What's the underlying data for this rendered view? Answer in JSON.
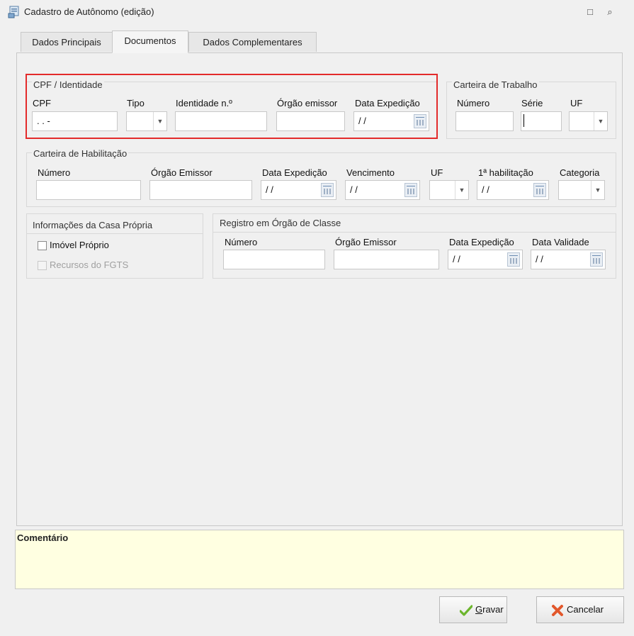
{
  "window": {
    "title": "Cadastro de Autônomo (edição)",
    "controls": {
      "restore_icon": "restore-icon",
      "close_icon": "close-icon"
    }
  },
  "tabs": [
    {
      "label": "Dados Principais",
      "active": false
    },
    {
      "label": "Documentos",
      "active": true
    },
    {
      "label": "Dados Complementares",
      "active": false
    }
  ],
  "cpf_group": {
    "title": "CPF / Identidade",
    "cpf_label": "CPF",
    "cpf_value": " .  .  -",
    "tipo_label": "Tipo",
    "tipo_value": "",
    "identidade_label": "Identidade n.º",
    "identidade_value": "",
    "orgao_label": "Órgão emissor",
    "orgao_value": "",
    "data_label": "Data Expedição",
    "data_value": "/ /"
  },
  "ctps_group": {
    "title": "Carteira de Trabalho",
    "numero_label": "Número",
    "numero_value": "",
    "serie_label": "Série",
    "serie_value": "",
    "uf_label": "UF",
    "uf_value": ""
  },
  "cnh_group": {
    "title": "Carteira de Habilitação",
    "numero_label": "Número",
    "numero_value": "",
    "orgao_label": "Órgão Emissor",
    "orgao_value": "",
    "data_exp_label": "Data Expedição",
    "data_exp_value": "/ /",
    "vencimento_label": "Vencimento",
    "vencimento_value": "/ /",
    "uf_label": "UF",
    "uf_value": "",
    "primeira_label": "1ª habilitação",
    "primeira_value": "/ /",
    "categoria_label": "Categoria",
    "categoria_value": ""
  },
  "casa_group": {
    "title": "Informações da Casa Própria",
    "imovel_label": "Imóvel Próprio",
    "imovel_checked": false,
    "fgts_label": "Recursos do FGTS",
    "fgts_checked": false
  },
  "classe_group": {
    "title": "Registro em Órgão de Classe",
    "numero_label": "Número",
    "numero_value": "",
    "orgao_label": "Órgão Emissor",
    "orgao_value": "",
    "data_exp_label": "Data Expedição",
    "data_exp_value": "/ /",
    "validade_label": "Data Validade",
    "validade_value": "/ /"
  },
  "comment": {
    "label": "Comentário",
    "value": ""
  },
  "buttons": {
    "save_label": "Gravar",
    "save_mnemonic": "G",
    "save_rest": "ravar",
    "cancel_label": "Cancelar"
  },
  "colors": {
    "highlight_border": "#e32b2b",
    "comment_bg": "#ffffe1",
    "save_icon": "#6cb52d",
    "cancel_icon": "#e2572b"
  }
}
